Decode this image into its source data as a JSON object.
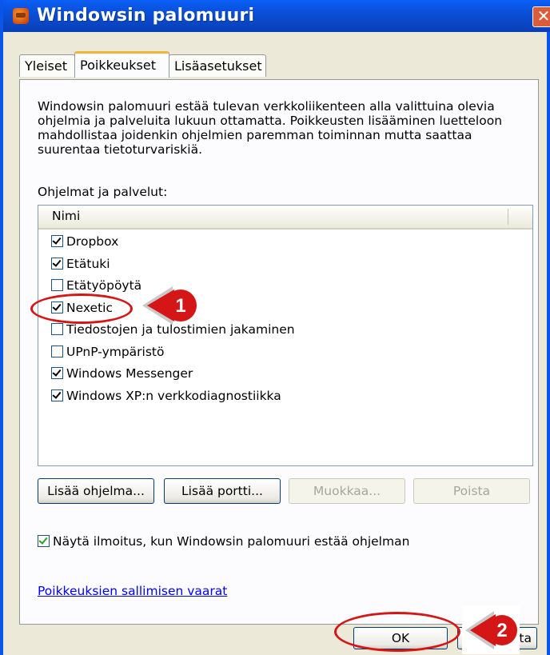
{
  "window": {
    "title": "Windowsin palomuuri",
    "close_label": "✕"
  },
  "tabs": [
    {
      "label": "Yleiset"
    },
    {
      "label": "Poikkeukset"
    },
    {
      "label": "Lisäasetukset"
    }
  ],
  "panel": {
    "intro_text": "Windowsin palomuuri estää tulevan verkkoliikenteen alla valittuina olevia ohjelmia ja palveluita lukuun ottamatta. Poikkeusten lisääminen luetteloon mahdollistaa joidenkin ohjelmien paremman toiminnan mutta saattaa suurentaa tietoturvariskiä.",
    "programs_label": "Ohjelmat ja palvelut:",
    "list_header": "Nimi",
    "items": [
      {
        "label": "Dropbox",
        "checked": true
      },
      {
        "label": "Etätuki",
        "checked": true
      },
      {
        "label": "Etätyöpöytä",
        "checked": false
      },
      {
        "label": "Nexetic",
        "checked": true
      },
      {
        "label": "Tiedostojen ja tulostimien jakaminen",
        "checked": false
      },
      {
        "label": "UPnP-ympäristö",
        "checked": false
      },
      {
        "label": "Windows Messenger",
        "checked": true
      },
      {
        "label": "Windows XP:n verkkodiagnostiikka",
        "checked": true
      }
    ],
    "buttons": {
      "add_program": "Lisää ohjelma...",
      "add_port": "Lisää portti...",
      "edit": "Muokkaa...",
      "remove": "Poista"
    },
    "notify_label": "Näytä ilmoitus, kun Windowsin palomuuri estää ohjelman",
    "notify_checked": true,
    "risk_link": "Poikkeuksien sallimisen vaarat"
  },
  "footer": {
    "ok_label": "OK",
    "cancel_label": "Peruuta"
  },
  "markers": [
    {
      "number": "1"
    },
    {
      "number": "2"
    }
  ],
  "colors": {
    "titlebar": "#0a5ef6",
    "marker_red": "#d41616",
    "link": "#0000ff"
  }
}
